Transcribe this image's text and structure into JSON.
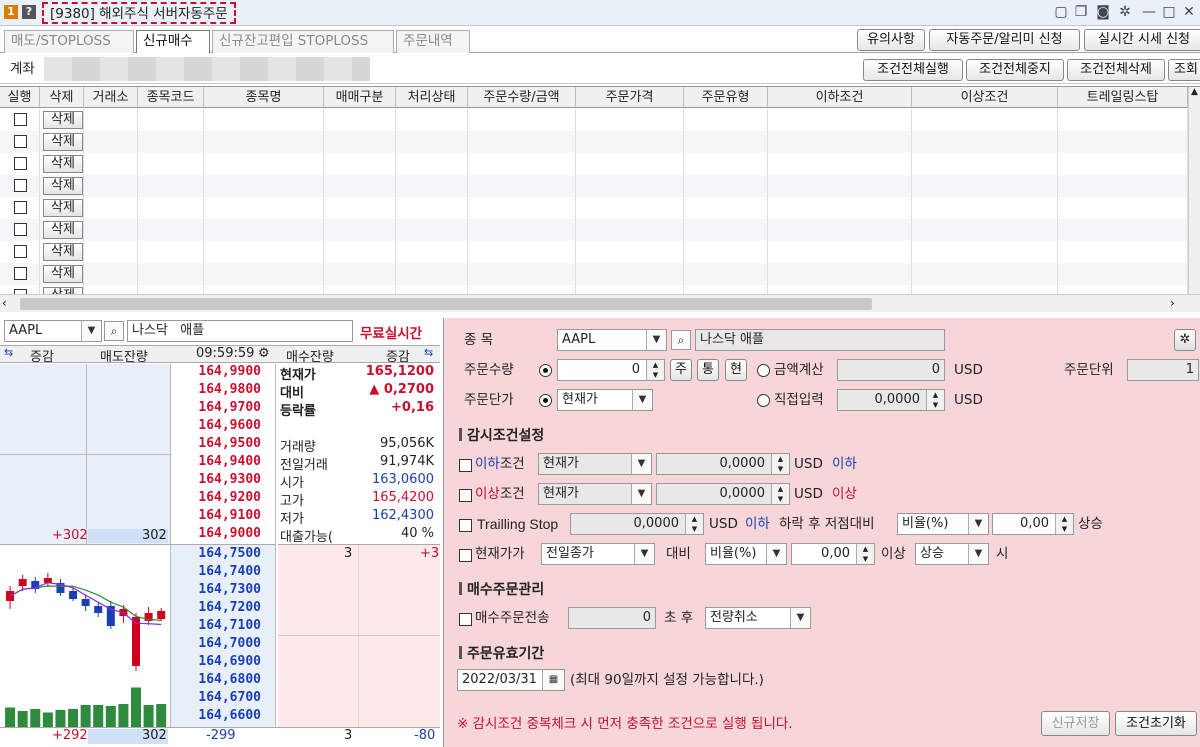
{
  "window": {
    "title": "[9380] 해외주식 서버자동주문",
    "icon1": "1",
    "icon2": "?"
  },
  "tabs": [
    "매도/STOPLOSS",
    "신규매수",
    "신규잔고편입 STOPLOSS",
    "주문내역"
  ],
  "top_buttons": [
    "유의사항",
    "자동주문/알리미 신청",
    "실시간 시세 신청"
  ],
  "account": {
    "label": "계좌"
  },
  "condition_buttons": [
    "조건전체실행",
    "조건전체중지",
    "조건전체삭제",
    "조회"
  ],
  "grid": {
    "columns": [
      "실행",
      "삭제",
      "거래소",
      "종목코드",
      "종목명",
      "매매구분",
      "처리상태",
      "주문수량/금액",
      "주문가격",
      "주문유형",
      "이하조건",
      "이상조건",
      "트레일링스탑"
    ],
    "delete_label": "삭제",
    "row_count": 9
  },
  "quote": {
    "symbol": "AAPL",
    "market": "나스닥",
    "name": "애플",
    "realtime_label": "무료실시간",
    "header": {
      "change": "증감",
      "sell_qty": "매도잔량",
      "time": "09:59:59",
      "buy_qty": "매수잔량",
      "change2": "증감"
    },
    "ask_prices": [
      "164,9900",
      "164,9800",
      "164,9700",
      "164,9600",
      "164,9500",
      "164,9400",
      "164,9300",
      "164,9200",
      "164,9100",
      "164,9000"
    ],
    "bid_prices": [
      "164,7500",
      "164,7400",
      "164,7300",
      "164,7200",
      "164,7100",
      "164,7000",
      "164,6900",
      "164,6800",
      "164,6700",
      "164,6600"
    ],
    "info": [
      {
        "label": "현재가",
        "value": "165,1200",
        "color": "red",
        "bold": true
      },
      {
        "label": "대비",
        "value": "▲    0,2700",
        "color": "red",
        "bold": true
      },
      {
        "label": "등락률",
        "value": "+0,16",
        "color": "red",
        "bold": true
      },
      {
        "label": "",
        "value": "",
        "color": "",
        "bold": false
      },
      {
        "label": "거래량",
        "value": "95,056K",
        "color": "",
        "bold": false
      },
      {
        "label": "전일거래",
        "value": "91,974K",
        "color": "",
        "bold": false
      },
      {
        "label": "시가",
        "value": "163,0600",
        "color": "blue",
        "bold": false
      },
      {
        "label": "고가",
        "value": "165,4200",
        "color": "red",
        "bold": false
      },
      {
        "label": "저가",
        "value": "162,4300",
        "color": "blue",
        "bold": false
      },
      {
        "label": "대출가능(",
        "value": "40 %",
        "color": "",
        "bold": false
      }
    ],
    "ask_total_change": "+302",
    "ask_total_qty": "302",
    "bid_first_qty": "3",
    "bid_first_change": "+3",
    "footer": {
      "ask_change": "+292",
      "ask_qty": "302",
      "diff": "-299",
      "bid_qty": "3",
      "bid_change": "-80"
    }
  },
  "mini_chart": {
    "candles": [
      {
        "o": 0.5,
        "c": 0.4,
        "h": 0.35,
        "l": 0.58,
        "up": true
      },
      {
        "o": 0.35,
        "c": 0.28,
        "h": 0.24,
        "l": 0.4,
        "up": true
      },
      {
        "o": 0.3,
        "c": 0.38,
        "h": 0.26,
        "l": 0.42,
        "up": false
      },
      {
        "o": 0.32,
        "c": 0.27,
        "h": 0.22,
        "l": 0.36,
        "up": true
      },
      {
        "o": 0.32,
        "c": 0.42,
        "h": 0.28,
        "l": 0.45,
        "up": false
      },
      {
        "o": 0.4,
        "c": 0.48,
        "h": 0.36,
        "l": 0.5,
        "up": false
      },
      {
        "o": 0.48,
        "c": 0.55,
        "h": 0.44,
        "l": 0.6,
        "up": false
      },
      {
        "o": 0.55,
        "c": 0.62,
        "h": 0.52,
        "l": 0.66,
        "up": false
      },
      {
        "o": 0.55,
        "c": 0.75,
        "h": 0.5,
        "l": 0.78,
        "up": false
      },
      {
        "o": 0.65,
        "c": 0.58,
        "h": 0.54,
        "l": 0.72,
        "up": true
      },
      {
        "o": 1.15,
        "c": 0.66,
        "h": 0.62,
        "l": 1.2,
        "up": true
      },
      {
        "o": 0.7,
        "c": 0.62,
        "h": 0.56,
        "l": 0.74,
        "up": true
      },
      {
        "o": 0.68,
        "c": 0.6,
        "h": 0.57,
        "l": 0.7,
        "up": true
      }
    ],
    "volumes": [
      0.45,
      0.38,
      0.42,
      0.35,
      0.4,
      0.42,
      0.5,
      0.5,
      0.48,
      0.52,
      0.85,
      0.5,
      0.52
    ]
  },
  "form": {
    "stock_label": "종   목",
    "symbol": "AAPL",
    "market_name": "나스닥   애플",
    "qty_label": "주문수량",
    "qty_value": "0",
    "btn_ju": "주",
    "btn_tong": "통",
    "btn_hyeon": "현",
    "amount_calc_label": "금액계산",
    "amount_value": "0",
    "usd": "USD",
    "unit_label": "주문단위",
    "unit_value": "1",
    "price_label": "주문단가",
    "price_type": "현재가",
    "direct_label": "직접입력",
    "direct_value": "0,0000",
    "monitor_title": "감시조건설정",
    "below_prefix": "이하",
    "below_suffix": "조건",
    "below_type": "현재가",
    "below_value": "0,0000",
    "below_tag": "이하",
    "above_prefix": "이상",
    "above_suffix": "조건",
    "above_type": "현재가",
    "above_value": "0,0000",
    "above_tag": "이상",
    "trailing_label": "Trailling Stop",
    "trailing_value": "0,0000",
    "trailing_below": "이하",
    "trailing_text": "하락 후 저점대비",
    "trailing_ratio_type": "비율(%)",
    "trailing_ratio": "0,00",
    "trailing_rise": "상승",
    "cur_label": "현재가가",
    "cur_type": "전일종가",
    "cur_vs": "대비",
    "cur_ratio_type": "비율(%)",
    "cur_ratio": "0,00",
    "cur_above": "이상",
    "cur_dir": "상승",
    "cur_end": "시",
    "buy_mgmt_title": "매수주문관리",
    "buy_send_label": "매수주문전송",
    "buy_send_value": "0",
    "buy_send_after": "초 후",
    "buy_cancel": "전량취소",
    "valid_title": "주문유효기간",
    "valid_date": "2022/03/31",
    "valid_note": "(최대 90일까지 설정 가능합니다.)",
    "warning": "※ 감시조건 중복체크 시 먼저 충족한 조건으로 실행 됩니다.",
    "save_button": "신규저장",
    "reset_button": "조건초기화"
  }
}
